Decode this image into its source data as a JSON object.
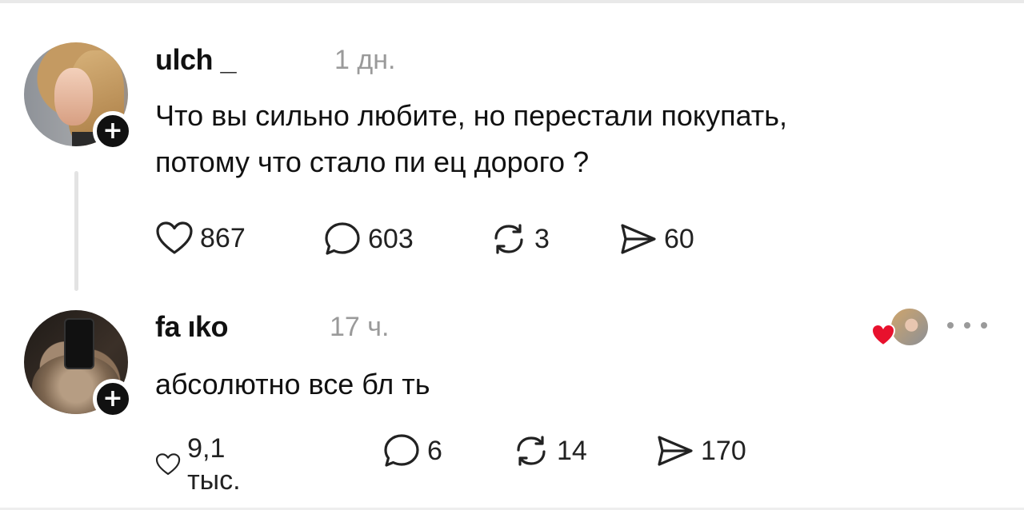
{
  "posts": [
    {
      "username": "ulch   _",
      "time": "1 дн.",
      "text_line1": "Что вы сильно любите, но перестали покупать,",
      "text_line2": "потому что стало пи  ец дорого ?",
      "likes": "867",
      "comments": "603",
      "reposts": "3",
      "shares": "60"
    },
    {
      "username": "fa    ıko",
      "time": "17 ч.",
      "text_line1": "абсолютно все бл  ть",
      "likes": "9,1 тыс.",
      "comments": "6",
      "reposts": "14",
      "shares": "170"
    }
  ],
  "icons": {
    "like": "heart-outline-icon",
    "comment": "speech-bubble-icon",
    "repost": "repost-arrows-icon",
    "share": "paper-plane-icon",
    "follow": "plus-icon",
    "more": "three-dots-icon",
    "liked_by_author": "red-heart-icon"
  },
  "colors": {
    "text": "#111111",
    "muted": "#9a9a9a",
    "heart_red": "#e8112d",
    "thread_line": "#e3e3e3"
  }
}
